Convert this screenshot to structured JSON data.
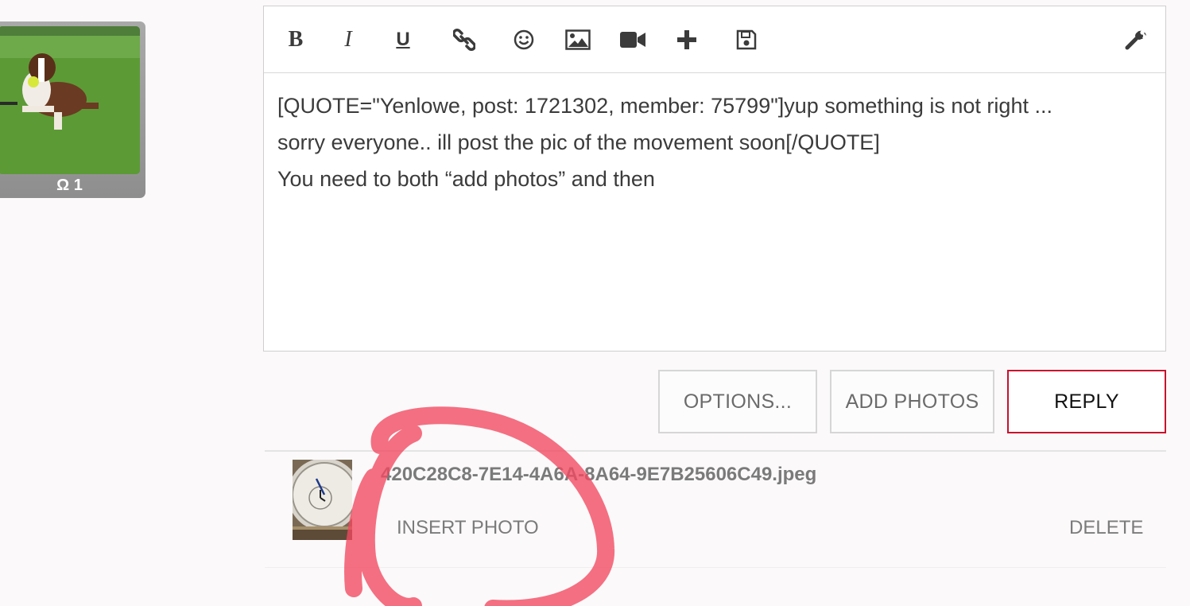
{
  "avatar": {
    "badge": "Ω 1",
    "photo_icon": "boxer-dog-photo"
  },
  "toolbar": {
    "bold": "B",
    "italic": "I",
    "underline": "U",
    "icons": [
      "bold-icon",
      "italic-icon",
      "underline-icon",
      "link-icon",
      "smiley-icon",
      "image-icon",
      "video-icon",
      "plus-icon",
      "save-icon",
      "wrench-icon"
    ]
  },
  "editor": {
    "lines": [
      "[QUOTE=\"Yenlowe, post: 1721302, member: 75799\"]yup something is not right ...",
      "sorry everyone.. ill post the pic of the movement soon[/QUOTE]",
      "You need to both “add photos” and then"
    ]
  },
  "buttons": {
    "options": "OPTIONS...",
    "add_photos": "ADD PHOTOS",
    "reply": "REPLY"
  },
  "attachment": {
    "filename": "420C28C8-7E14-4A6A-8A64-9E7B25606C49.jpeg",
    "insert": "INSERT PHOTO",
    "delete": "DELETE"
  },
  "colors": {
    "accent": "#c8102e",
    "annotation": "#f2485f"
  }
}
